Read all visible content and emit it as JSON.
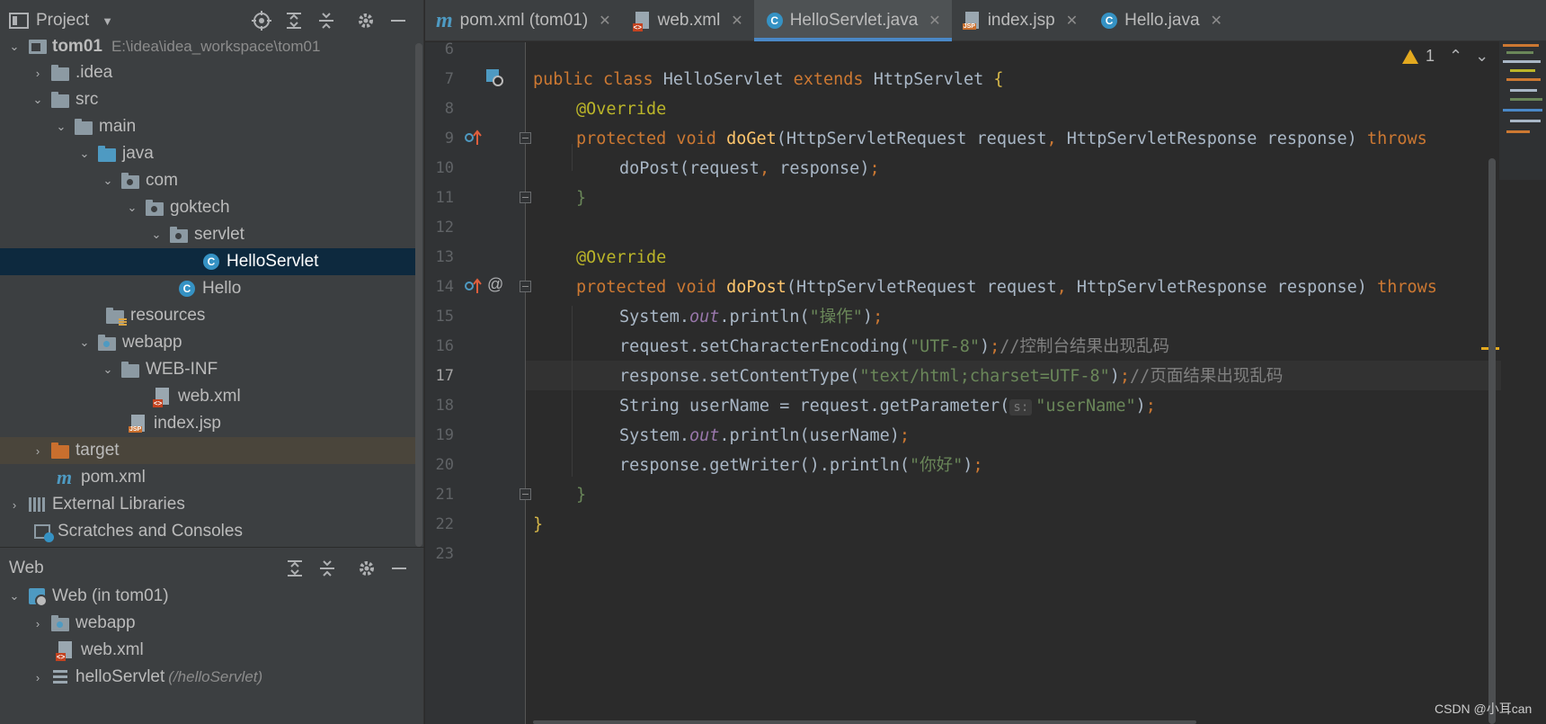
{
  "project_panel": {
    "title": "Project",
    "tree": [
      {
        "label": "tom01",
        "path": "E:\\idea\\idea_workspace\\tom01"
      },
      {
        "label": ".idea"
      },
      {
        "label": "src"
      },
      {
        "label": "main"
      },
      {
        "label": "java"
      },
      {
        "label": "com"
      },
      {
        "label": "goktech"
      },
      {
        "label": "servlet"
      },
      {
        "label": "HelloServlet"
      },
      {
        "label": "Hello"
      },
      {
        "label": "resources"
      },
      {
        "label": "webapp"
      },
      {
        "label": "WEB-INF"
      },
      {
        "label": "web.xml"
      },
      {
        "label": "index.jsp"
      },
      {
        "label": "target"
      },
      {
        "label": "pom.xml"
      },
      {
        "label": "External Libraries"
      },
      {
        "label": "Scratches and Consoles"
      }
    ]
  },
  "web_panel": {
    "title": "Web",
    "tree": [
      {
        "label": "Web (in tom01)"
      },
      {
        "label": "webapp"
      },
      {
        "label": "web.xml"
      },
      {
        "label": "helloServlet",
        "path": "(/helloServlet)"
      }
    ]
  },
  "tabs": [
    {
      "label": "pom.xml (tom01)",
      "close": "✕"
    },
    {
      "label": "web.xml",
      "close": "✕"
    },
    {
      "label": "HelloServlet.java",
      "close": "✕"
    },
    {
      "label": "index.jsp",
      "close": "✕"
    },
    {
      "label": "Hello.java",
      "close": "✕"
    }
  ],
  "active_tab": "HelloServlet.java",
  "editor": {
    "warning_count": "1",
    "current_line": "17",
    "line_numbers": [
      "6",
      "7",
      "8",
      "9",
      "10",
      "11",
      "12",
      "13",
      "14",
      "15",
      "16",
      "17",
      "18",
      "19",
      "20",
      "21",
      "22",
      "23"
    ],
    "code": {
      "l7_a": "public class ",
      "l7_b": "HelloServlet ",
      "l7_c": "extends ",
      "l7_d": "HttpServlet ",
      "l7_e": "{",
      "l8": "@Override",
      "l9_a": "protected void ",
      "l9_b": "doGet",
      "l9_c": "(HttpServletRequest request",
      "l9_d": ", ",
      "l9_e": "HttpServletResponse response) ",
      "l9_f": "throws",
      "l10_a": "doPost(request",
      "l10_b": ", ",
      "l10_c": "response)",
      "l10_d": ";",
      "l11": "}",
      "l13": "@Override",
      "l14_a": "protected void ",
      "l14_b": "doPost",
      "l14_c": "(HttpServletRequest request",
      "l14_d": ", ",
      "l14_e": "HttpServletResponse response) ",
      "l14_f": "throws",
      "l15_a": "System.",
      "l15_b": "out",
      "l15_c": ".println(",
      "l15_d": "\"操作\"",
      "l15_e": ")",
      "l15_f": ";",
      "l16_a": "request.setCharacterEncoding(",
      "l16_b": "\"UTF-8\"",
      "l16_c": ")",
      "l16_d": ";",
      "l16_e": "//控制台结果出现乱码",
      "l17_a": "response.setContentType(",
      "l17_b": "\"text/html;charset=UTF-8\"",
      "l17_c": ")",
      "l17_d": ";",
      "l17_e": "//页面结果出现乱码",
      "l18_a": "String userName = request.getParameter(",
      "l18_hint": "s:",
      "l18_b": "\"userName\"",
      "l18_c": ")",
      "l18_d": ";",
      "l19_a": "System.",
      "l19_b": "out",
      "l19_c": ".println(userName)",
      "l19_d": ";",
      "l20_a": "response.getWriter().println(",
      "l20_b": "\"你好\"",
      "l20_c": ")",
      "l20_d": ";",
      "l21": "}",
      "l22": "}"
    }
  },
  "watermark": "CSDN @小耳can",
  "colors": {
    "keyword": "#cc7832",
    "annotation": "#bbb529",
    "method": "#ffc66d",
    "string": "#6a8759",
    "comment": "#808080",
    "selection": "#0d293e",
    "accent": "#4a88c7"
  }
}
